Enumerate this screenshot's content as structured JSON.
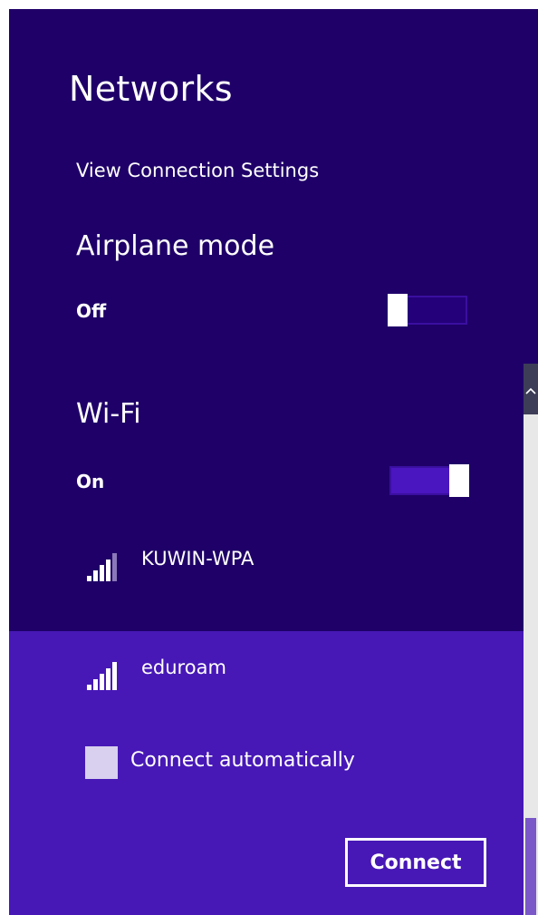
{
  "panel": {
    "title": "Networks",
    "view_settings_link": "View Connection Settings"
  },
  "airplane_mode": {
    "heading": "Airplane mode",
    "state_label": "Off",
    "enabled": false
  },
  "wifi": {
    "heading": "Wi-Fi",
    "state_label": "On",
    "enabled": true
  },
  "networks": [
    {
      "name": "KUWIN-WPA",
      "signal_icon": "wifi-signal-icon",
      "signal_bars": 4,
      "selected": false
    },
    {
      "name": "eduroam",
      "signal_icon": "wifi-signal-icon",
      "signal_bars": 5,
      "selected": true
    }
  ],
  "selected_network": {
    "connect_automatically_label": "Connect automatically",
    "connect_automatically_checked": false,
    "connect_button_label": "Connect"
  },
  "colors": {
    "panel_bg": "#1f0068",
    "selected_bg": "#4718b6",
    "text": "#ffffff"
  }
}
